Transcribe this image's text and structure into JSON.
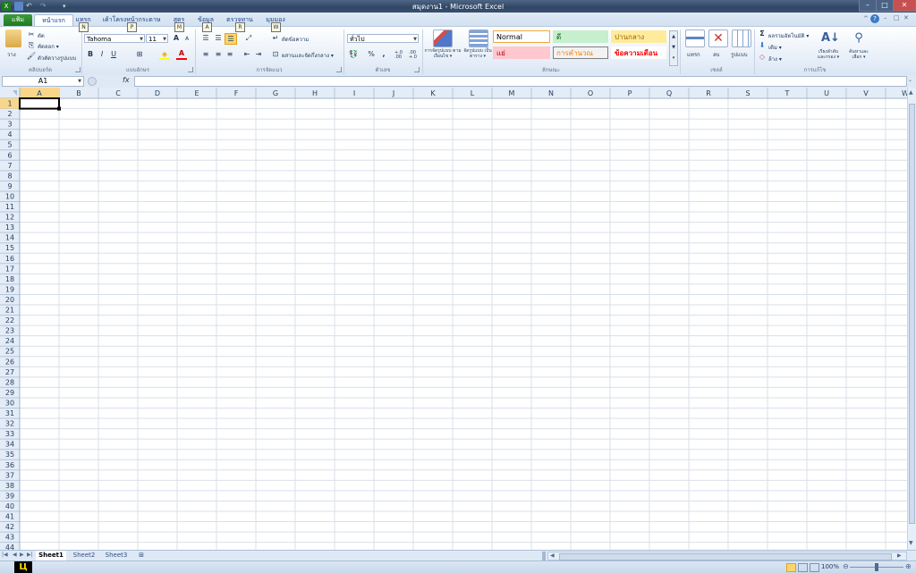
{
  "window": {
    "title": "สมุดงาน1 - Microsoft Excel",
    "controls": [
      "–",
      "□",
      "✕"
    ],
    "ribbon_controls": [
      "^",
      "?",
      "–",
      "□",
      "✕"
    ]
  },
  "tabs": [
    {
      "label": "แฟ้ม",
      "active": false
    },
    {
      "label": "หน้าแรก",
      "active": true
    },
    {
      "label": "แทรก",
      "active": false
    },
    {
      "label": "เค้าโครงหน้ากระดาษ",
      "active": false
    },
    {
      "label": "สูตร",
      "active": false
    },
    {
      "label": "ข้อมูล",
      "active": false
    },
    {
      "label": "ตรวจทาน",
      "active": false
    },
    {
      "label": "มุมมอง",
      "active": false
    }
  ],
  "keytips": [
    "N",
    "P",
    "M",
    "A",
    "R",
    "W"
  ],
  "ribbon": {
    "clipboard": {
      "label": "คลิปบอร์ด",
      "paste": "วาง",
      "cut": "ตัด",
      "copy": "คัดลอก ▾",
      "format_painter": "ตัวคัดวางรูปแบบ"
    },
    "font": {
      "label": "แบบอักษร",
      "font_name": "Tahoma",
      "font_size": "11",
      "bold": "B",
      "italic": "I",
      "underline": "U",
      "grow": "A",
      "shrink": "A",
      "font_color_letter": "A"
    },
    "alignment": {
      "label": "การจัดแนว",
      "wrap_text": "ตัดข้อความ",
      "merge_center": "ผสานและจัดกึ่งกลาง ▾"
    },
    "number": {
      "label": "ตัวเลข",
      "format": "ทั่วไป",
      "percent": "%",
      "comma": ",",
      "inc_decimal": "+.0 .00",
      "dec_decimal": ".00 +.0"
    },
    "styles": {
      "label": "ลักษณะ",
      "conditional": "การจัดรูปแบบ ตามเงื่อนไข ▾",
      "format_as_table": "จัดรูปแบบ เป็นตาราง ▾",
      "cells": [
        {
          "text": "Normal",
          "bg": "#ffffff",
          "fg": "#000000",
          "border": "#f2a93b"
        },
        {
          "text": "ดี",
          "bg": "#c6efce",
          "fg": "#006100",
          "border": "#c6efce"
        },
        {
          "text": "ปานกลาง",
          "bg": "#ffeb9c",
          "fg": "#9c6500",
          "border": "#ffeb9c"
        },
        {
          "text": "แย่",
          "bg": "#ffc7ce",
          "fg": "#9c0006",
          "border": "#ffc7ce"
        },
        {
          "text": "การคำนวณ",
          "bg": "#f2f2f2",
          "fg": "#fa7d00",
          "border": "#7f7f7f"
        },
        {
          "text": "ข้อความเตือน",
          "bg": "#ffffff",
          "fg": "#ff0000",
          "border": "#ffffff"
        }
      ]
    },
    "cells": {
      "label": "เซลล์",
      "insert": "แทรก",
      "delete": "ลบ",
      "format": "รูปแบบ"
    },
    "editing": {
      "label": "การแก้ไข",
      "autosum": "ผลรวมอัตโนมัติ ▾",
      "fill": "เติม ▾",
      "clear": "ล้าง ▾",
      "sort_filter": "เรียงลำดับ และกรอง ▾",
      "find_select": "ค้นหาและ เลือก ▾"
    }
  },
  "formula_bar": {
    "name_box": "A1",
    "fx": "fx",
    "content": ""
  },
  "grid": {
    "columns": [
      "A",
      "B",
      "C",
      "D",
      "E",
      "F",
      "G",
      "H",
      "I",
      "J",
      "K",
      "L",
      "M",
      "N",
      "O",
      "P",
      "Q",
      "R",
      "S",
      "T",
      "U",
      "V",
      "W"
    ],
    "selected_cell": "A1",
    "accent": "#f7c96f",
    "selected_header": "#f9d78a"
  },
  "sheets": [
    {
      "label": "Sheet1",
      "active": true
    },
    {
      "label": "Sheet2",
      "active": false
    },
    {
      "label": "Sheet3",
      "active": false
    }
  ],
  "status": {
    "zoom": "100%"
  }
}
